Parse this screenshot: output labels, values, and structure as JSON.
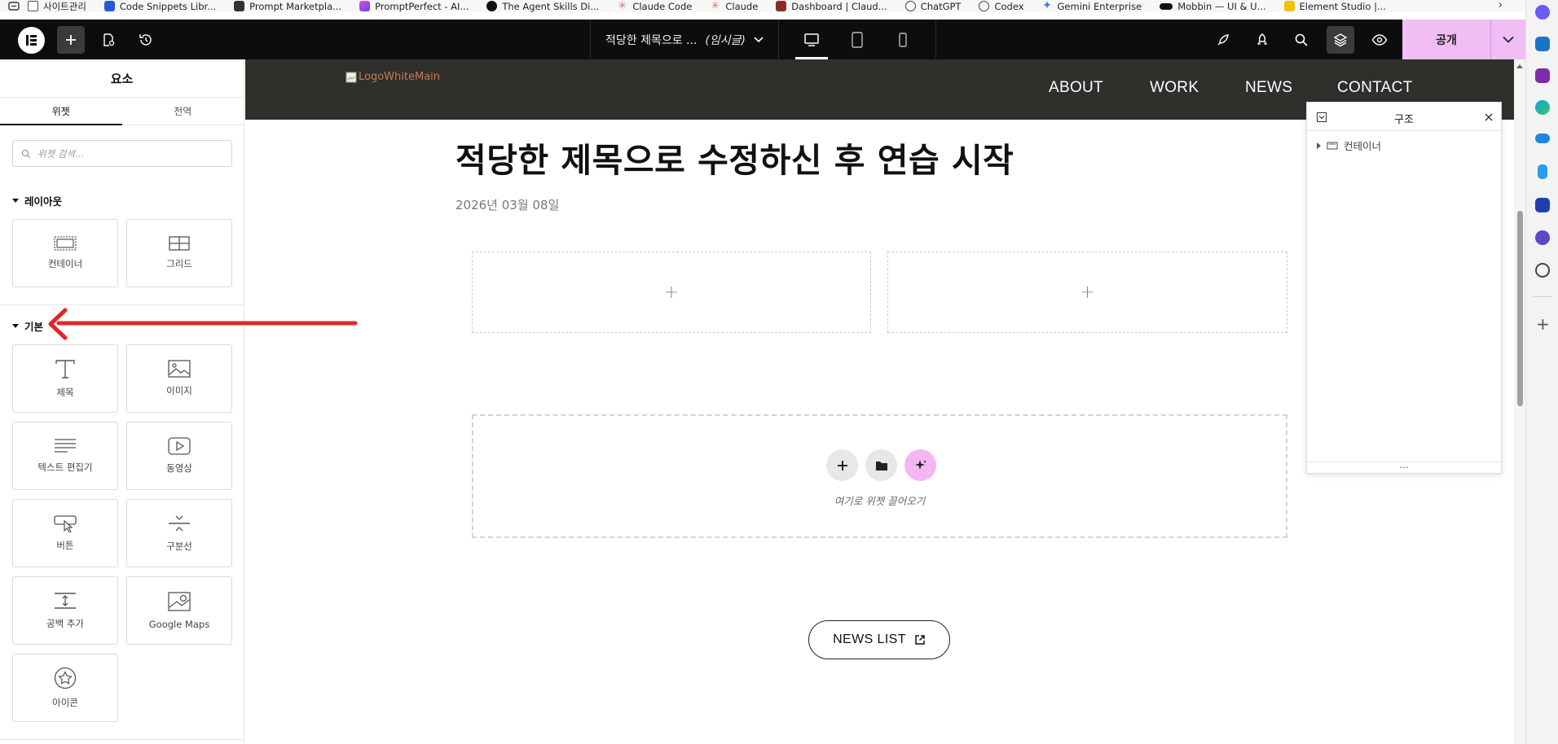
{
  "bookmarks": [
    {
      "label": "사이트관리",
      "icon": "folder-icon",
      "color": "#666666"
    },
    {
      "label": "Code Snippets Libr...",
      "icon": "code-snippets-icon",
      "color": "#2557d6"
    },
    {
      "label": "Prompt Marketpla...",
      "icon": "prompt-marketplace-icon",
      "color": "#333333"
    },
    {
      "label": "PromptPerfect - AI...",
      "icon": "promptperfect-icon",
      "color": "#7b3fe4"
    },
    {
      "label": "The Agent Skills Di...",
      "icon": "agent-skills-icon",
      "color": "#111111"
    },
    {
      "label": "Claude Code",
      "icon": "claude-icon",
      "color": "#d97757"
    },
    {
      "label": "Claude",
      "icon": "claude-icon",
      "color": "#d97757"
    },
    {
      "label": "Dashboard | Claud...",
      "icon": "dashboard-icon",
      "color": "#8a2b2b"
    },
    {
      "label": "ChatGPT",
      "icon": "chatgpt-icon",
      "color": "#444444"
    },
    {
      "label": "Codex",
      "icon": "codex-icon",
      "color": "#444444"
    },
    {
      "label": "Gemini Enterprise",
      "icon": "gemini-icon",
      "color": "#3f7df0"
    },
    {
      "label": "Mobbin — UI & U...",
      "icon": "mobbin-icon",
      "color": "#111111"
    },
    {
      "label": "Element Studio |...",
      "icon": "element-studio-icon",
      "color": "#f2c200"
    }
  ],
  "topbar": {
    "doc_title": "적당한 제목으로 ...",
    "doc_status": "(임시글)",
    "publish_label": "공개",
    "accent": "#f0bdf5"
  },
  "panel": {
    "title": "요소",
    "tabs": [
      "위젯",
      "전역"
    ],
    "search_placeholder": "위젯 검색...",
    "layout_section": "레이아웃",
    "layout_widgets": [
      "컨테이너",
      "그리드"
    ],
    "basic_section": "기본",
    "basic_widgets": [
      "제목",
      "이미지",
      "텍스트 편집기",
      "동영상",
      "버튼",
      "구분선",
      "공백 추가",
      "Google Maps",
      "아이콘"
    ]
  },
  "site": {
    "logo_alt": "LogoWhiteMain",
    "nav": [
      "ABOUT",
      "WORK",
      "NEWS",
      "CONTACT"
    ],
    "header_bg": "#2f2f2c"
  },
  "post": {
    "title": "적당한 제목으로 수정하신 후 연습 시작",
    "date": "2026년 03월 08일",
    "dropzone_hint": "여기로 위젯 끌어오기",
    "news_button": "NEWS LIST"
  },
  "structure": {
    "title": "구조",
    "item": "컨테이너",
    "footer": "..."
  },
  "annotation": {
    "color": "#e0262c"
  }
}
